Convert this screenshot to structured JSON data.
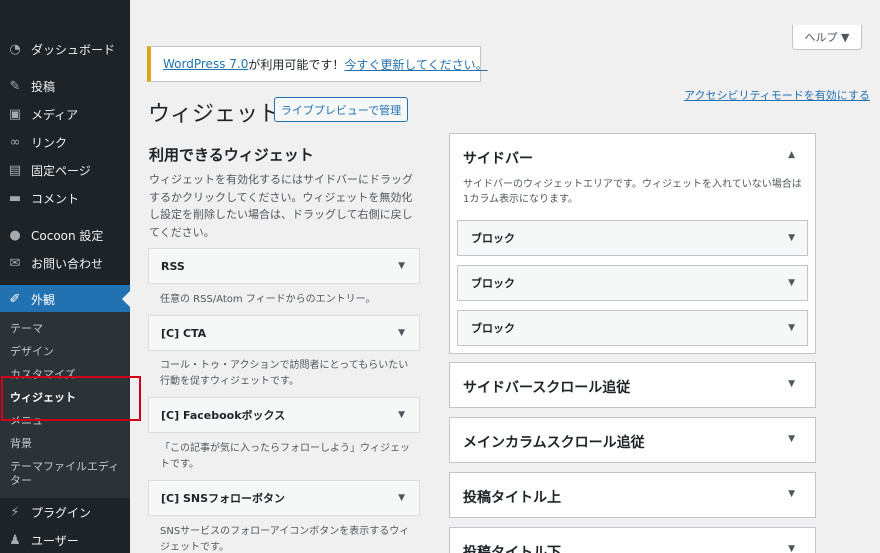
{
  "sidebar": {
    "items": [
      {
        "label": "ダッシュボード",
        "icon": "dashboard-icon"
      },
      {
        "label": "投稿",
        "icon": "pin-icon"
      },
      {
        "label": "メディア",
        "icon": "media-icon"
      },
      {
        "label": "リンク",
        "icon": "link-icon"
      },
      {
        "label": "固定ページ",
        "icon": "page-icon"
      },
      {
        "label": "コメント",
        "icon": "comment-icon"
      },
      {
        "label": "Cocoon 設定",
        "icon": "circle-icon"
      },
      {
        "label": "お問い合わせ",
        "icon": "mail-icon"
      },
      {
        "label": "外観",
        "icon": "brush-icon"
      },
      {
        "label": "プラグイン",
        "icon": "plugin-icon"
      },
      {
        "label": "ユーザー",
        "icon": "user-icon"
      }
    ],
    "submenu": [
      {
        "label": "テーマ"
      },
      {
        "label": "デザイン"
      },
      {
        "label": "カスタマイズ"
      },
      {
        "label": "ウィジェット"
      },
      {
        "label": "メニュー"
      },
      {
        "label": "背景"
      },
      {
        "label": "テーマファイルエディター"
      }
    ],
    "active_color": "#2271b1"
  },
  "header": {
    "help_label": "ヘルプ ▼",
    "notice": {
      "link1": "WordPress 7.0",
      "text": " が利用可能です！",
      "link2": "今すぐ更新してください。"
    },
    "a11y_link": "アクセシビリティモードを有効にする",
    "title": "ウィジェット",
    "preview_button": "ライブプレビューで管理"
  },
  "available": {
    "title": "利用できるウィジェット",
    "description": "ウィジェットを有効化するにはサイドバーにドラッグするかクリックしてください。ウィジェットを無効化し設定を削除したい場合は、ドラッグして右側に戻してください。",
    "widgets": [
      {
        "name": "RSS",
        "desc": "任意の RSS/Atom フィードからのエントリー。"
      },
      {
        "name": "[C] CTA",
        "desc": "コール・トゥ・アクションで訪問者にとってもらいたい行動を促すウィジェットです。"
      },
      {
        "name": "[C] Facebookボックス",
        "desc": "「この記事が気に入ったらフォローしよう」ウィジェットです。"
      },
      {
        "name": "[C] SNSフォローボタン",
        "desc": "SNSサービスのフォローアイコンボタンを表示するウィジェットです。"
      }
    ]
  },
  "areas": {
    "sidebar": {
      "title": "サイドバー",
      "description": "サイドバーのウィジェットエリアです。ウィジェットを入れていない場合は1カラム表示になります。",
      "blocks": [
        "ブロック",
        "ブロック",
        "ブロック"
      ]
    },
    "others": [
      "サイドバースクロール追従",
      "メインカラムスクロール追従",
      "投稿タイトル上",
      "投稿タイトル下"
    ]
  }
}
